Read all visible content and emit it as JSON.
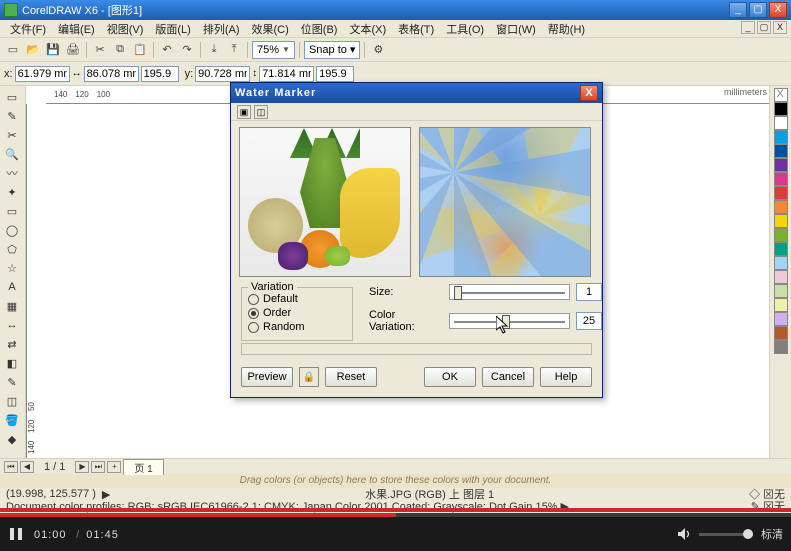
{
  "titlebar": {
    "text": "CorelDRAW X6 - [图形1]",
    "min": "_",
    "max": "▢",
    "close": "X"
  },
  "menubar": {
    "items": [
      "文件(F)",
      "编辑(E)",
      "视图(V)",
      "版面(L)",
      "排列(A)",
      "效果(C)",
      "位图(B)",
      "文本(X)",
      "表格(T)",
      "工具(O)",
      "窗口(W)",
      "帮助(H)"
    ],
    "child_btns": [
      "_",
      "▢",
      "X"
    ]
  },
  "toolbar1": {
    "zoom": "75%",
    "snap": "Snap to ▾"
  },
  "toolbar2": {
    "x_label": "x:",
    "x": "61.979 mm",
    "x2": "86.078 mm",
    "w": "195.9",
    "y_label": "y:",
    "y": "90.728 mm",
    "y2": "71.814 mm",
    "h": "195.9"
  },
  "rulers": {
    "h": [
      "140",
      "120",
      "100"
    ],
    "v": [
      "140",
      "120",
      "50"
    ],
    "label": "millimeters"
  },
  "palette": [
    "#ffffff",
    "#000000",
    "#00a1e4",
    "#e03a3a",
    "#f5d400",
    "#7ab02e",
    "#00a080",
    "#ff8a00",
    "#b45a2a",
    "#f5c9d6",
    "#aad4f0",
    "#c8e0a8",
    "#f0f0a8",
    "#d0b0f0",
    "#808080",
    "#f0a8a8",
    "#a04a00"
  ],
  "status": {
    "page_of": "1 / 1",
    "page_tab": "页 1",
    "hint": "Drag colors (or objects) here to store these colors with your document.",
    "coords": "(19.998, 125.577 )",
    "play": "▶",
    "doc": "水果.JPG (RGB) 上 图层 1",
    "profiles": "Document color profiles: RGB: sRGB IEC61966-2.1; CMYK: Japan Color 2001 Coated; Grayscale: Dot Gain 15%   ▶",
    "fill_none": "无",
    "stroke_none": "无"
  },
  "dialog": {
    "title": "Water Marker",
    "close": "X",
    "variation_legend": "Variation",
    "radios": [
      "Default",
      "Order",
      "Random"
    ],
    "radio_selected": 1,
    "size_label": "Size:",
    "size_value": "1",
    "colorvar_label": "Color Variation:",
    "colorvar_value": "25",
    "preview": "Preview",
    "reset": "Reset",
    "ok": "OK",
    "cancel": "Cancel",
    "help": "Help",
    "lock": "🔒"
  },
  "video": {
    "current": "01:00",
    "total": "01:45",
    "quality": "标清"
  }
}
